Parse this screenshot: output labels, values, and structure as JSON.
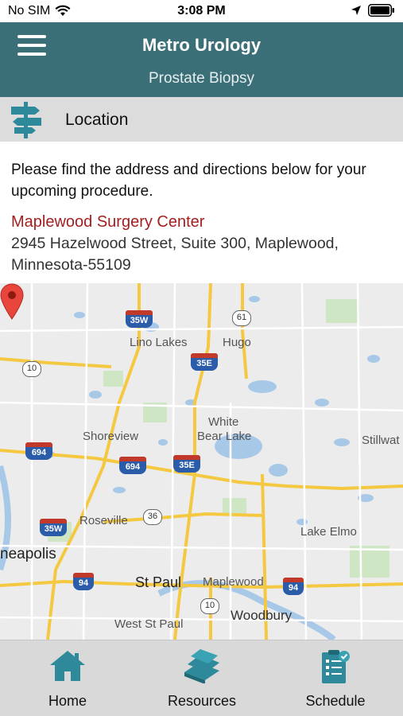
{
  "status_bar": {
    "carrier": "No SIM",
    "time": "3:08 PM"
  },
  "header": {
    "title": "Metro Urology",
    "subtitle": "Prostate Biopsy",
    "menu_icon": "hamburger-menu-icon",
    "background_color": "#3b6f78"
  },
  "section": {
    "title": "Location",
    "icon": "signpost-icon"
  },
  "content": {
    "intro": "Please find the address and directions below for your upcoming procedure.",
    "facility_name": "Maplewood Surgery Center",
    "address_line1": "2945 Hazelwood Street, Suite 300, Maplewood,",
    "address_line2": "Minnesota-55109"
  },
  "map": {
    "places": {
      "lino_lakes": "Lino Lakes",
      "hugo": "Hugo",
      "shoreview": "Shoreview",
      "white": "White",
      "bear_lake": "Bear Lake",
      "stillwater": "Stillwat",
      "roseville": "Roseville",
      "lake_elmo": "Lake Elmo",
      "minneapolis": "neapolis",
      "st_paul": "St Paul",
      "maplewood": "Maplewood",
      "woodbury": "Woodbury",
      "west_st_paul": "West St Paul"
    },
    "shields": {
      "i35w_north": "35W",
      "us61": "61",
      "i35e_north": "35E",
      "r10_west": "10",
      "i694_west": "694",
      "i694_mid": "694",
      "i35e_mid": "35E",
      "r36": "36",
      "i35w_south": "35W",
      "i94_west": "94",
      "r10_south": "10",
      "i94_east": "94"
    },
    "marker_icon": "location-pin-icon"
  },
  "tabs": [
    {
      "label": "Home",
      "icon": "home-icon"
    },
    {
      "label": "Resources",
      "icon": "books-icon"
    },
    {
      "label": "Schedule",
      "icon": "checklist-icon"
    }
  ],
  "colors": {
    "accent": "#3b6f78",
    "facility_name": "#a32020",
    "icon_teal": "#2e8a9a"
  }
}
